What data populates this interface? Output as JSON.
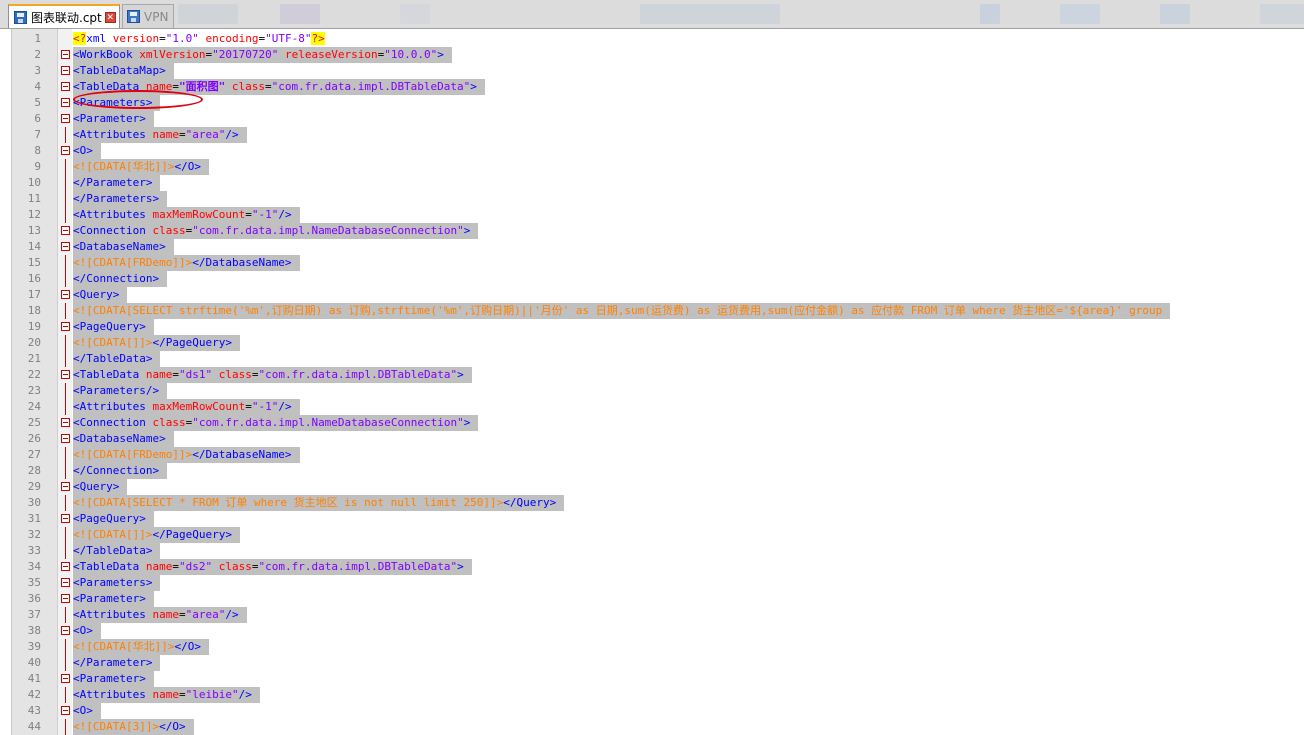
{
  "tabs": [
    {
      "label": "图表联动.cpt",
      "active": true,
      "icon": "save-icon"
    },
    {
      "label": "VPN",
      "active": false,
      "icon": "save-icon"
    }
  ],
  "colors": {
    "tag": "#0000ff",
    "attr": "#ff0000",
    "value": "#8000ff",
    "cdata": "#ff8000",
    "selection": "#c0c0c0",
    "annotation": "#e0000e"
  },
  "lines": [
    {
      "n": "1",
      "fold": "none",
      "tokens": [
        [
          "pi",
          "<?"
        ],
        [
          "tag",
          "xml "
        ],
        [
          "attr",
          "version"
        ],
        [
          "plain",
          "="
        ],
        [
          "val",
          "\"1.0\""
        ],
        [
          "plain",
          " "
        ],
        [
          "attr",
          "encoding"
        ],
        [
          "plain",
          "="
        ],
        [
          "val",
          "\"UTF-8\""
        ],
        [
          "pi",
          "?>"
        ]
      ]
    },
    {
      "n": "2",
      "fold": "box",
      "tokens": [
        [
          "tag",
          "<WorkBook "
        ],
        [
          "attr",
          "xmlVersion"
        ],
        [
          "plain",
          "="
        ],
        [
          "val",
          "\"20170720\""
        ],
        [
          "plain",
          " "
        ],
        [
          "attr",
          "releaseVersion"
        ],
        [
          "plain",
          "="
        ],
        [
          "val",
          "\"10.0.0\""
        ],
        [
          "tag",
          ">"
        ]
      ]
    },
    {
      "n": "3",
      "fold": "box",
      "tokens": [
        [
          "tag",
          "<TableDataMap>"
        ]
      ]
    },
    {
      "n": "4",
      "fold": "box",
      "tokens": [
        [
          "tag",
          "<TableData "
        ],
        [
          "attr",
          "name"
        ],
        [
          "plain",
          "="
        ],
        [
          "valb",
          "\"面积图\""
        ],
        [
          "plain",
          " "
        ],
        [
          "attr",
          "class"
        ],
        [
          "plain",
          "="
        ],
        [
          "val",
          "\"com.fr.data.impl.DBTableData\""
        ],
        [
          "tag",
          ">"
        ]
      ]
    },
    {
      "n": "5",
      "fold": "box",
      "tokens": [
        [
          "tag",
          "<Parameters>"
        ]
      ]
    },
    {
      "n": "6",
      "fold": "box",
      "tokens": [
        [
          "tag",
          "<Parameter>"
        ]
      ]
    },
    {
      "n": "7",
      "fold": "line",
      "tokens": [
        [
          "tag",
          "<Attributes "
        ],
        [
          "attr",
          "name"
        ],
        [
          "plain",
          "="
        ],
        [
          "val",
          "\"area\""
        ],
        [
          "tag",
          "/>"
        ]
      ]
    },
    {
      "n": "8",
      "fold": "box",
      "tokens": [
        [
          "tag",
          "<O>"
        ]
      ]
    },
    {
      "n": "9",
      "fold": "line",
      "tokens": [
        [
          "cdata",
          "<![CDATA[华北]]>"
        ],
        [
          "tag",
          "</O>"
        ]
      ]
    },
    {
      "n": "10",
      "fold": "line",
      "tokens": [
        [
          "tag",
          "</Parameter>"
        ]
      ]
    },
    {
      "n": "11",
      "fold": "line",
      "tokens": [
        [
          "tag",
          "</Parameters>"
        ]
      ]
    },
    {
      "n": "12",
      "fold": "line",
      "tokens": [
        [
          "tag",
          "<Attributes "
        ],
        [
          "attr",
          "maxMemRowCount"
        ],
        [
          "plain",
          "="
        ],
        [
          "val",
          "\"-1\""
        ],
        [
          "tag",
          "/>"
        ]
      ]
    },
    {
      "n": "13",
      "fold": "box",
      "tokens": [
        [
          "tag",
          "<Connection "
        ],
        [
          "attr",
          "class"
        ],
        [
          "plain",
          "="
        ],
        [
          "val",
          "\"com.fr.data.impl.NameDatabaseConnection\""
        ],
        [
          "tag",
          ">"
        ]
      ]
    },
    {
      "n": "14",
      "fold": "box",
      "tokens": [
        [
          "tag",
          "<DatabaseName>"
        ]
      ]
    },
    {
      "n": "15",
      "fold": "line",
      "tokens": [
        [
          "cdata",
          "<![CDATA[FRDemo]]>"
        ],
        [
          "tag",
          "</DatabaseName>"
        ]
      ]
    },
    {
      "n": "16",
      "fold": "line",
      "tokens": [
        [
          "tag",
          "</Connection>"
        ]
      ]
    },
    {
      "n": "17",
      "fold": "box",
      "tokens": [
        [
          "tag",
          "<Query>"
        ]
      ]
    },
    {
      "n": "18",
      "fold": "line",
      "tokens": [
        [
          "cdata",
          "<![CDATA[SELECT strftime('%m',订购日期) as 订购,strftime('%m',订购日期)||'月份' as 日期,sum(运货费) as 运货费用,sum(应付金额) as 应付款 FROM 订单 where 货主地区='${area}' group"
        ]
      ]
    },
    {
      "n": "19",
      "fold": "box",
      "tokens": [
        [
          "tag",
          "<PageQuery>"
        ]
      ]
    },
    {
      "n": "20",
      "fold": "line",
      "tokens": [
        [
          "cdata",
          "<![CDATA[]]>"
        ],
        [
          "tag",
          "</PageQuery>"
        ]
      ]
    },
    {
      "n": "21",
      "fold": "line",
      "tokens": [
        [
          "tag",
          "</TableData>"
        ]
      ]
    },
    {
      "n": "22",
      "fold": "box",
      "tokens": [
        [
          "tag",
          "<TableData "
        ],
        [
          "attr",
          "name"
        ],
        [
          "plain",
          "="
        ],
        [
          "val",
          "\"ds1\""
        ],
        [
          "plain",
          " "
        ],
        [
          "attr",
          "class"
        ],
        [
          "plain",
          "="
        ],
        [
          "val",
          "\"com.fr.data.impl.DBTableData\""
        ],
        [
          "tag",
          ">"
        ]
      ]
    },
    {
      "n": "23",
      "fold": "line",
      "tokens": [
        [
          "tag",
          "<Parameters/>"
        ]
      ]
    },
    {
      "n": "24",
      "fold": "line",
      "tokens": [
        [
          "tag",
          "<Attributes "
        ],
        [
          "attr",
          "maxMemRowCount"
        ],
        [
          "plain",
          "="
        ],
        [
          "val",
          "\"-1\""
        ],
        [
          "tag",
          "/>"
        ]
      ]
    },
    {
      "n": "25",
      "fold": "box",
      "tokens": [
        [
          "tag",
          "<Connection "
        ],
        [
          "attr",
          "class"
        ],
        [
          "plain",
          "="
        ],
        [
          "val",
          "\"com.fr.data.impl.NameDatabaseConnection\""
        ],
        [
          "tag",
          ">"
        ]
      ]
    },
    {
      "n": "26",
      "fold": "box",
      "tokens": [
        [
          "tag",
          "<DatabaseName>"
        ]
      ]
    },
    {
      "n": "27",
      "fold": "line",
      "tokens": [
        [
          "cdata",
          "<![CDATA[FRDemo]]>"
        ],
        [
          "tag",
          "</DatabaseName>"
        ]
      ]
    },
    {
      "n": "28",
      "fold": "line",
      "tokens": [
        [
          "tag",
          "</Connection>"
        ]
      ]
    },
    {
      "n": "29",
      "fold": "box",
      "tokens": [
        [
          "tag",
          "<Query>"
        ]
      ]
    },
    {
      "n": "30",
      "fold": "line",
      "tokens": [
        [
          "cdata",
          "<![CDATA[SELECT * FROM 订单 where 货主地区 is not null limit 250]]>"
        ],
        [
          "tag",
          "</Query>"
        ]
      ]
    },
    {
      "n": "31",
      "fold": "box",
      "tokens": [
        [
          "tag",
          "<PageQuery>"
        ]
      ]
    },
    {
      "n": "32",
      "fold": "line",
      "tokens": [
        [
          "cdata",
          "<![CDATA[]]>"
        ],
        [
          "tag",
          "</PageQuery>"
        ]
      ]
    },
    {
      "n": "33",
      "fold": "line",
      "tokens": [
        [
          "tag",
          "</TableData>"
        ]
      ]
    },
    {
      "n": "34",
      "fold": "box",
      "tokens": [
        [
          "tag",
          "<TableData "
        ],
        [
          "attr",
          "name"
        ],
        [
          "plain",
          "="
        ],
        [
          "val",
          "\"ds2\""
        ],
        [
          "plain",
          " "
        ],
        [
          "attr",
          "class"
        ],
        [
          "plain",
          "="
        ],
        [
          "val",
          "\"com.fr.data.impl.DBTableData\""
        ],
        [
          "tag",
          ">"
        ]
      ]
    },
    {
      "n": "35",
      "fold": "box",
      "tokens": [
        [
          "tag",
          "<Parameters>"
        ]
      ]
    },
    {
      "n": "36",
      "fold": "box",
      "tokens": [
        [
          "tag",
          "<Parameter>"
        ]
      ]
    },
    {
      "n": "37",
      "fold": "line",
      "tokens": [
        [
          "tag",
          "<Attributes "
        ],
        [
          "attr",
          "name"
        ],
        [
          "plain",
          "="
        ],
        [
          "val",
          "\"area\""
        ],
        [
          "tag",
          "/>"
        ]
      ]
    },
    {
      "n": "38",
      "fold": "box",
      "tokens": [
        [
          "tag",
          "<O>"
        ]
      ]
    },
    {
      "n": "39",
      "fold": "line",
      "tokens": [
        [
          "cdata",
          "<![CDATA[华北]]>"
        ],
        [
          "tag",
          "</O>"
        ]
      ]
    },
    {
      "n": "40",
      "fold": "line",
      "tokens": [
        [
          "tag",
          "</Parameter>"
        ]
      ]
    },
    {
      "n": "41",
      "fold": "box",
      "tokens": [
        [
          "tag",
          "<Parameter>"
        ]
      ]
    },
    {
      "n": "42",
      "fold": "line",
      "tokens": [
        [
          "tag",
          "<Attributes "
        ],
        [
          "attr",
          "name"
        ],
        [
          "plain",
          "="
        ],
        [
          "val",
          "\"leibie\""
        ],
        [
          "tag",
          "/>"
        ]
      ]
    },
    {
      "n": "43",
      "fold": "box",
      "tokens": [
        [
          "tag",
          "<O>"
        ]
      ]
    },
    {
      "n": "44",
      "fold": "line",
      "tokens": [
        [
          "cdata",
          "<![CDATA[3]]>"
        ],
        [
          "tag",
          "</O>"
        ]
      ]
    }
  ]
}
